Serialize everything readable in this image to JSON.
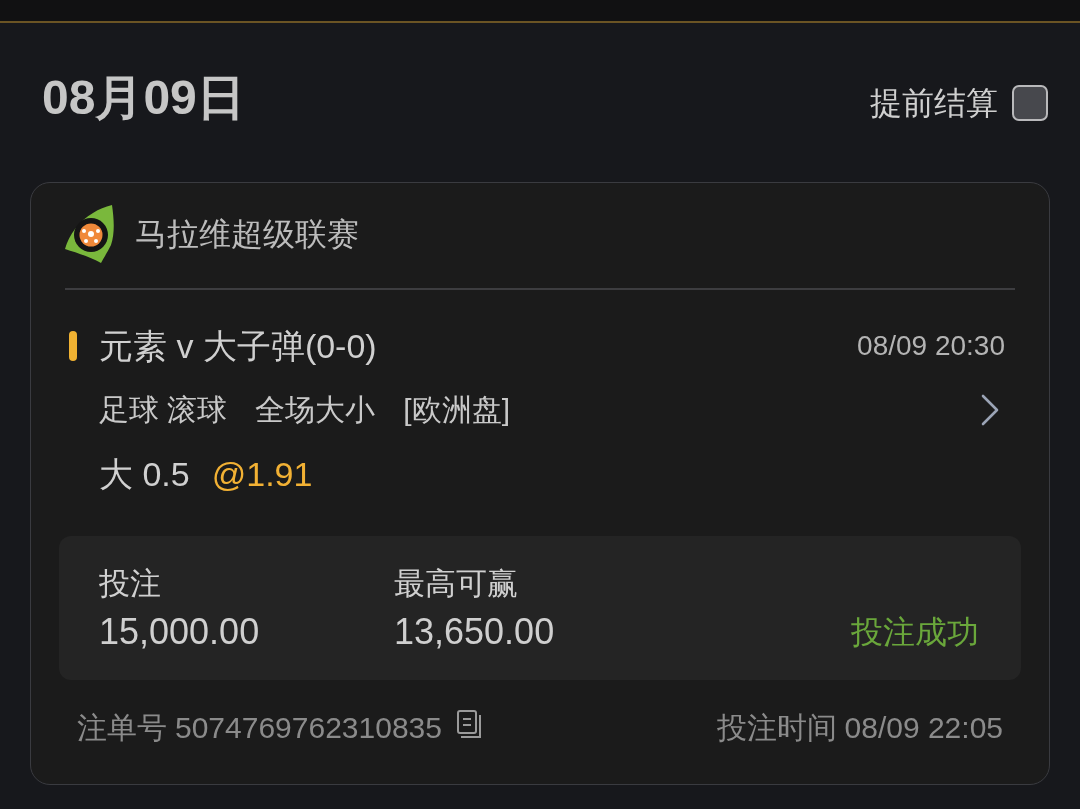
{
  "date_header": {
    "date": "08月09日",
    "early_settlement": {
      "label": "提前结算",
      "checked": false
    }
  },
  "bet_card": {
    "league": "马拉维超级联赛",
    "match": {
      "title": "元素 v 大子弹(0-0)",
      "time": "08/09 20:30",
      "market_parts": [
        "足球 滚球",
        "全场大小",
        "[欧洲盘]"
      ],
      "selection": "大 0.5",
      "odds": "@1.91"
    },
    "summary": [
      {
        "label": "投注",
        "value": "15,000.00"
      },
      {
        "label": "最高可赢",
        "value": "13,650.00"
      }
    ],
    "status": {
      "label": "投注成功",
      "kind": "success"
    },
    "order": {
      "label": "注单号",
      "number": "5074769762310835"
    },
    "bet_time": {
      "label": "投注时间",
      "value": "08/09 22:05"
    }
  }
}
